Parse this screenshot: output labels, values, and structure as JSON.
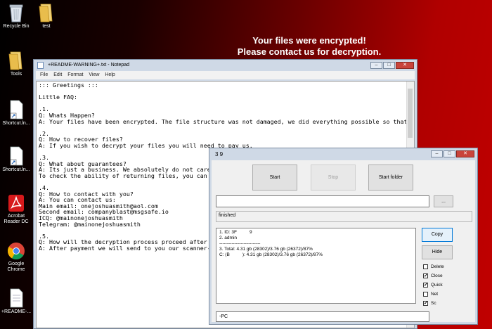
{
  "desktop": {
    "icons": [
      {
        "label": "Recycle Bin",
        "icon": "recycle-bin-icon"
      },
      {
        "label": "test",
        "icon": "folder-icon"
      },
      {
        "label": "Tools",
        "icon": "folder-icon"
      },
      {
        "label": "Shortcut.ln...",
        "icon": "shortcut-file-icon"
      },
      {
        "label": "Shortcut.ln...",
        "icon": "shortcut-file-icon"
      },
      {
        "label": "Acrobat Reader DC",
        "icon": "acrobat-icon"
      },
      {
        "label": "Google Chrome",
        "icon": "chrome-icon"
      },
      {
        "label": "+README-...",
        "icon": "text-file-icon"
      }
    ],
    "ransom_line1": "Your files were encrypted!",
    "ransom_line2": "Please contact us for decryption.",
    "background_colors": [
      "#000000",
      "#c00000"
    ]
  },
  "notepad": {
    "title": "+README-WARNING+.txt - Notepad",
    "menu": [
      "File",
      "Edit",
      "Format",
      "View",
      "Help"
    ],
    "content": "::: Greetings :::\n\nLittle FAQ:\n\n.1.\nQ: Whats Happen?\nA: Your files have been encrypted. The file structure was not damaged, we did everything possible so that t\n\n.2.\nQ: How to recover files?\nA: If you wish to decrypt your files you will need to pay us.\n\n.3.\nQ: What about guarantees?\nA: Its just a business. We absolutely do not care\nTo check the ability of returning files, you can s\n\n.4.\nQ: How to contact with you?\nA: You can contact us:\nMain email: onejoshuasmith@aol.com\nSecond email: companyblast@msgsafe.io\nICQ: @mainonejoshuasmith\nTelegram: @mainonejoshuasmith\n\n.5.\nQ: How will the decryption process proceed after p\nA: After payment we will send to you our scanner-d"
  },
  "decryptor": {
    "title": "3          9",
    "start_label": "Start",
    "stop_label": "Stop",
    "start_folder_label": "Start folder",
    "path_value": "",
    "browse_label": "...",
    "status": "finished",
    "log": [
      "1. ID: 3F          9",
      "2. admin",
      "---------------------------",
      "3. Total: 4.31 gb (28302)/3.76 gb (26372)/87%",
      "C: (B          ): 4.31 gb (28302)/3.76 gb (26372)/87%"
    ],
    "copy_label": "Copy",
    "hide_label": "Hide",
    "options": [
      {
        "label": "Delete",
        "checked": false
      },
      {
        "label": "Close",
        "checked": true
      },
      {
        "label": "Quick",
        "checked": true
      },
      {
        "label": "Net",
        "checked": false
      },
      {
        "label": "Sc",
        "checked": true
      }
    ],
    "bottom_field": "-PC"
  }
}
